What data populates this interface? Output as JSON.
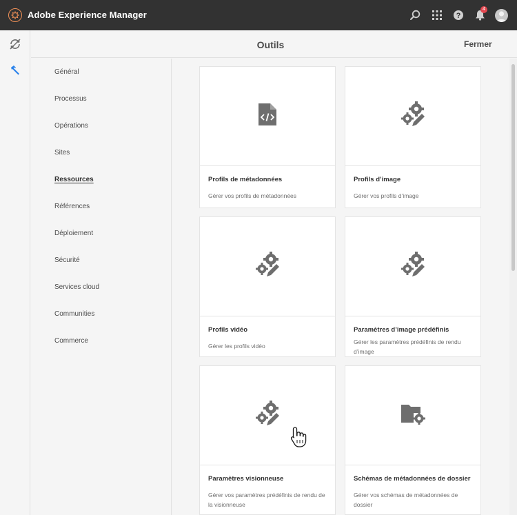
{
  "app": {
    "title": "Adobe Experience Manager",
    "notification_count": "4"
  },
  "header": {
    "title": "Outils",
    "close_label": "Fermer"
  },
  "nav": {
    "items": [
      {
        "label": "Général",
        "active": false
      },
      {
        "label": "Processus",
        "active": false
      },
      {
        "label": "Opérations",
        "active": false
      },
      {
        "label": "Sites",
        "active": false
      },
      {
        "label": "Ressources",
        "active": true
      },
      {
        "label": "Références",
        "active": false
      },
      {
        "label": "Déploiement",
        "active": false
      },
      {
        "label": "Sécurité",
        "active": false
      },
      {
        "label": "Services cloud",
        "active": false
      },
      {
        "label": "Communities",
        "active": false
      },
      {
        "label": "Commerce",
        "active": false
      }
    ]
  },
  "cards": [
    {
      "title": "Profils de métadonnées",
      "desc": "Gérer vos profils de métadonnées",
      "icon": "code-file-icon"
    },
    {
      "title": "Profils d’image",
      "desc": "Gérer vos profils d’image",
      "icon": "gears-edit-icon"
    },
    {
      "title": "Profils vidéo",
      "desc": "Gérer les profils vidéo",
      "icon": "gears-edit-icon"
    },
    {
      "title": "Paramètres d’image prédéfinis",
      "desc": "Gérer les paramètres prédéfinis de rendu d’image",
      "icon": "gears-edit-icon"
    },
    {
      "title": "Paramètres visionneuse",
      "desc": "Gérer vos paramètres prédéfinis de rendu de la visionneuse",
      "icon": "gears-edit-icon"
    },
    {
      "title": "Schémas de métadonnées de dossier",
      "desc": "Gérer vos schémas de métadonnées de dossier",
      "icon": "folder-gear-icon"
    }
  ],
  "colors": {
    "topbar": "#323232",
    "accent": "#2680eb",
    "badge": "#e34850",
    "logo": "#f29157"
  }
}
